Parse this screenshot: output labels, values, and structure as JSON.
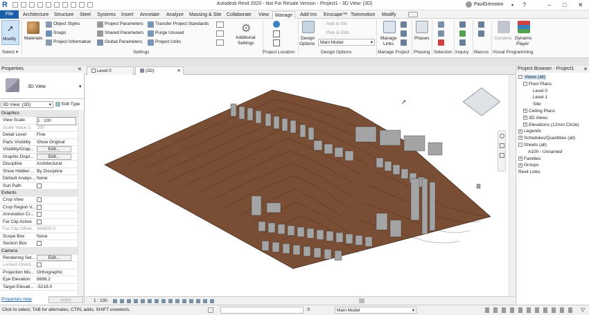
{
  "window": {
    "title": "Autodesk Revit 2020 - Not For Resale Version - Project1 - 3D View: {3D}",
    "user": "PaulGrimston"
  },
  "tabs": [
    "File",
    "Architecture",
    "Structure",
    "Steel",
    "Systems",
    "Insert",
    "Annotate",
    "Analyze",
    "Massing & Site",
    "Collaborate",
    "View",
    "Manage",
    "Add-Ins",
    "Enscape™",
    "Twinmotion",
    "Modify"
  ],
  "active_tab": "Manage",
  "ribbon": {
    "select": {
      "modify": "Modify",
      "label": "Select ▾"
    },
    "settings": {
      "materials": "Materials",
      "object_styles": "Object  Styles",
      "snaps": "Snaps",
      "project_information": "Project  Information",
      "project_parameters": "Project  Parameters",
      "shared_parameters": "Shared  Parameters",
      "global_parameters": "Global  Parameters",
      "transfer_standards": "Transfer  Project Standards",
      "purge_unused": "Purge  Unused",
      "project_units": "Project  Units",
      "additional_settings_1": "Additional",
      "additional_settings_2": "Settings",
      "label": "Settings"
    },
    "project_location": {
      "label": "Project Location"
    },
    "design_options": {
      "btn1": "Design",
      "btn2": "Options",
      "add_to_set": "Add to Set",
      "pick_to_edit": "Pick to Edit",
      "main_model": "Main Model",
      "label": "Design Options"
    },
    "manage_project": {
      "manage_links_1": "Manage",
      "manage_links_2": "Links",
      "label": "Manage Project"
    },
    "phasing": {
      "phases": "Phases",
      "label": "Phasing"
    },
    "selection": {
      "label": "Selection"
    },
    "inquiry": {
      "label": "Inquiry"
    },
    "macros": {
      "label": "Macros"
    },
    "visual_programming": {
      "dynamo": "Dynamo",
      "dynamo_player_1": "Dynamo",
      "dynamo_player_2": "Player",
      "label": "Visual Programming"
    }
  },
  "properties": {
    "title": "Properties",
    "type_name": "3D View",
    "selector": "3D View: {3D}",
    "edit_type": "Edit Type",
    "sections": [
      {
        "name": "Graphics",
        "rows": [
          {
            "k": "View Scale",
            "v": "1 : 100"
          },
          {
            "k": "Scale Value  1:",
            "v": "100"
          },
          {
            "k": "Detail Level",
            "v": "Fine"
          },
          {
            "k": "Parts Visibility",
            "v": "Show Original"
          },
          {
            "k": "Visibility/Grap...",
            "v": "Edit..."
          },
          {
            "k": "Graphic Displ...",
            "v": "Edit..."
          },
          {
            "k": "Discipline",
            "v": "Architectural"
          },
          {
            "k": "Show Hidden ...",
            "v": "By Discipline"
          },
          {
            "k": "Default Analys...",
            "v": "None"
          },
          {
            "k": "Sun Path",
            "v": ""
          }
        ]
      },
      {
        "name": "Extents",
        "rows": [
          {
            "k": "Crop View",
            "v": ""
          },
          {
            "k": "Crop Region V...",
            "v": ""
          },
          {
            "k": "Annotation Cr...",
            "v": ""
          },
          {
            "k": "Far Clip Active",
            "v": ""
          },
          {
            "k": "Far Clip Offset",
            "v": "304800.0"
          },
          {
            "k": "Scope Box",
            "v": "None"
          },
          {
            "k": "Section Box",
            "v": ""
          }
        ]
      },
      {
        "name": "Camera",
        "rows": [
          {
            "k": "Rendering Set...",
            "v": "Edit..."
          },
          {
            "k": "Locked Orient...",
            "v": ""
          },
          {
            "k": "Projection Mo...",
            "v": "Orthographic"
          },
          {
            "k": "Eye Elevation",
            "v": "6686.2"
          },
          {
            "k": "Target Elevati...",
            "v": "-5219.0"
          }
        ]
      }
    ],
    "help": "Properties help",
    "apply": "Apply"
  },
  "view_tabs": [
    {
      "label": "Level 0"
    },
    {
      "label": "{3D}"
    }
  ],
  "view_scale": "1 : 100",
  "browser": {
    "title": "Project Browser - Project1",
    "nodes": [
      {
        "label": "Views (all)",
        "indent": 0,
        "exp": "-"
      },
      {
        "label": "Floor Plans",
        "indent": 1,
        "exp": "-"
      },
      {
        "label": "Level 0",
        "indent": 3,
        "exp": ""
      },
      {
        "label": "Level 1",
        "indent": 3,
        "exp": ""
      },
      {
        "label": "Site",
        "indent": 3,
        "exp": ""
      },
      {
        "label": "Ceiling Plans",
        "indent": 1,
        "exp": "+"
      },
      {
        "label": "3D Views",
        "indent": 1,
        "exp": "+"
      },
      {
        "label": "Elevations (12mm Circle)",
        "indent": 1,
        "exp": "+"
      },
      {
        "label": "Legends",
        "indent": 0,
        "exp": "+"
      },
      {
        "label": "Schedules/Quantities (all)",
        "indent": 0,
        "exp": "+"
      },
      {
        "label": "Sheets (all)",
        "indent": 0,
        "exp": "-"
      },
      {
        "label": "A100 - Unnamed",
        "indent": 2,
        "exp": ""
      },
      {
        "label": "Families",
        "indent": 0,
        "exp": "+"
      },
      {
        "label": "Groups",
        "indent": 0,
        "exp": "+"
      },
      {
        "label": "Revit Links",
        "indent": 0,
        "exp": ""
      }
    ]
  },
  "statusbar": {
    "message": "Click to select, TAB for alternates, CTRL adds, SHIFT unselects.",
    "model": "Main Model",
    "zero": ":0"
  },
  "colors": {
    "accent": "#1a5fa8",
    "terrain": "#7a4e34",
    "building": "#9a9a9a"
  }
}
